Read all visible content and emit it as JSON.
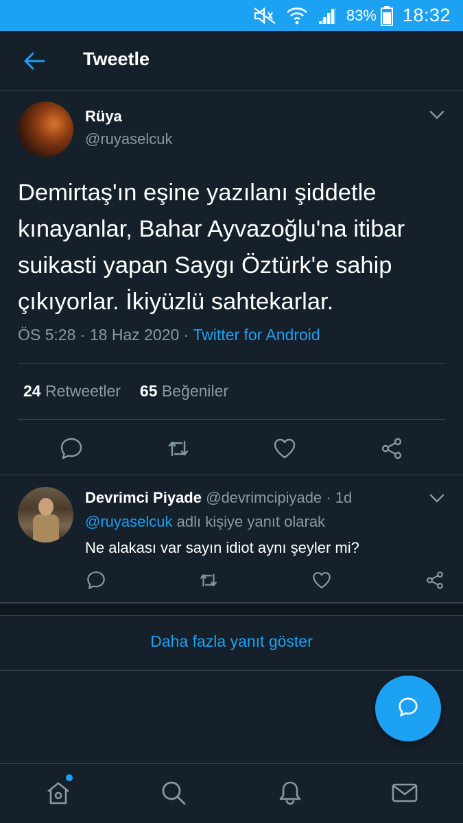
{
  "status_bar": {
    "battery_percent": "83%",
    "time": "18:32",
    "icons": [
      "mute-icon",
      "wifi-icon",
      "signal-icon",
      "battery-icon"
    ]
  },
  "header": {
    "title": "Tweetle",
    "back_icon": "back-arrow-icon"
  },
  "tweet": {
    "author_name": "Rüya",
    "author_handle": "@ruyaselcuk",
    "text": "Demirtaş'ın eşine yazılanı şiddetle kınayanlar, Bahar Ayvazoğlu'na itibar suikasti yapan Saygı Öztürk'e sahip çıkıyorlar. İkiyüzlü sahtekarlar.",
    "time": "ÖS 5:28",
    "date": "18 Haz 2020",
    "source": "Twitter for Android",
    "retweets_count": "24",
    "retweets_label": "Retweetler",
    "likes_count": "65",
    "likes_label": "Beğeniler",
    "actions": [
      "reply-icon",
      "retweet-icon",
      "like-icon",
      "share-icon"
    ]
  },
  "reply": {
    "author_name": "Devrimci Piyade",
    "author_handle": "@devrimcipiyade",
    "age": "1d",
    "reply_mention": "@ruyaselcuk",
    "reply_suffix": "adlı kişiye yanıt olarak",
    "text": "Ne alakası var sayın idiot aynı şeyler mi?"
  },
  "more_replies": "Daha fazla yanıt göster",
  "fab_icon": "compose-reply-icon",
  "bottom_nav": [
    "home-icon",
    "search-icon",
    "notifications-icon",
    "messages-icon"
  ],
  "colors": {
    "background": "#15202b",
    "accent": "#1da1f2",
    "muted": "#8899a6",
    "border": "#38444d"
  }
}
